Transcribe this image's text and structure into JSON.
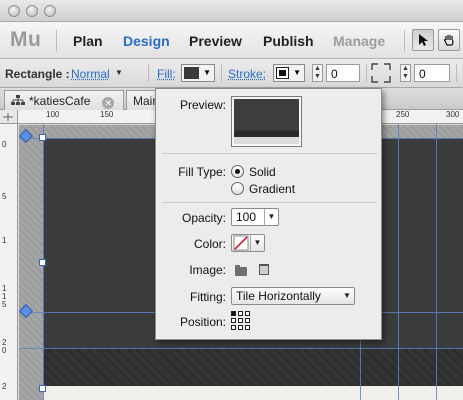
{
  "app": {
    "logo": "Mu"
  },
  "nav": {
    "items": [
      {
        "label": "Plan",
        "state": "normal"
      },
      {
        "label": "Design",
        "state": "active"
      },
      {
        "label": "Preview",
        "state": "normal"
      },
      {
        "label": "Publish",
        "state": "normal"
      },
      {
        "label": "Manage",
        "state": "disabled"
      }
    ],
    "tools": [
      "selection-arrow-icon",
      "hand-tool-icon"
    ]
  },
  "control_bar": {
    "object_type": "Rectangle :",
    "state_link": "Normal",
    "fill_label": "Fill:",
    "stroke_label": "Stroke:",
    "stroke_width": "0",
    "corner_radius": "0",
    "fill_color": "#3a3a3a"
  },
  "tabs": [
    {
      "label": "*katiesCafe",
      "icon": "sitemap-icon"
    },
    {
      "label": "Main"
    }
  ],
  "rulers": {
    "horizontal": [
      "100",
      "150",
      "250",
      "300"
    ],
    "vertical": [
      "0",
      "5",
      "1",
      "1",
      "1",
      "5",
      "2",
      "0",
      "2"
    ]
  },
  "fill_panel": {
    "preview_label": "Preview:",
    "fill_type_label": "Fill Type:",
    "fill_type_options": [
      "Solid",
      "Gradient"
    ],
    "fill_type_selected": "Solid",
    "opacity_label": "Opacity:",
    "opacity_value": "100",
    "color_label": "Color:",
    "color_value": "none",
    "image_label": "Image:",
    "fitting_label": "Fitting:",
    "fitting_value": "Tile Horizontally",
    "position_label": "Position:",
    "position_selected": "top-left"
  },
  "colors": {
    "accent": "#2a6ec7",
    "page_background": "#3c3c3c",
    "guide": "#5b83c7"
  }
}
